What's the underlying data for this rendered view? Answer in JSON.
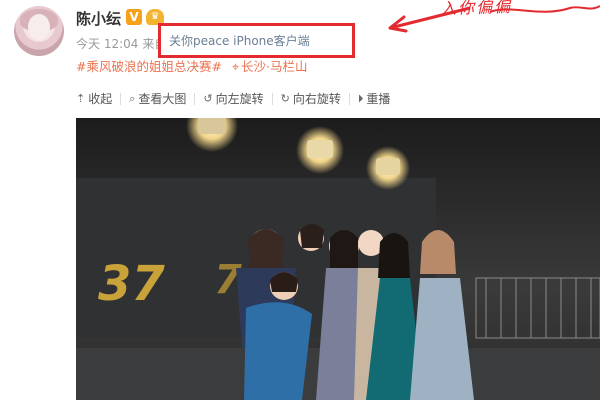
{
  "post": {
    "author": "陈小纭",
    "verified_badge": "V",
    "time": "今天 12:04",
    "from_prefix": "来自",
    "source": "关你peace iPhone客户端",
    "annotation_text": "入你偏偏",
    "topic": "#乘风破浪的姐姐总决赛#",
    "location": "长沙·马栏山"
  },
  "toolbar": {
    "collapse": "收起",
    "view_large": "查看大图",
    "rotate_left": "向左旋转",
    "rotate_right": "向右旋转",
    "replay": "重播"
  },
  "photo": {
    "logo_text": "37"
  },
  "colors": {
    "link": "#eb7350",
    "highlight_box": "#e32a2f",
    "source_text": "#6b7f95",
    "badge_v": "#f7a11a"
  },
  "icons": {
    "collapse": "arrow-up-icon",
    "view_large": "magnifier-icon",
    "rotate_left": "rotate-left-icon",
    "rotate_right": "rotate-right-icon",
    "replay": "play-circle-icon",
    "location": "location-pin-icon"
  }
}
